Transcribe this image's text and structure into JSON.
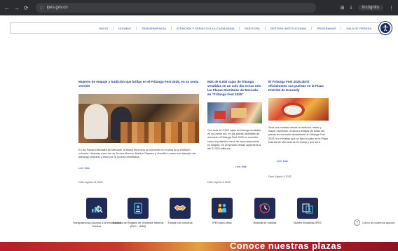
{
  "browser": {
    "url": "ipes.gov.co",
    "profile_label": "Incógnito"
  },
  "menu": {
    "items": [
      "INICIO",
      "IDIOMAS",
      "TRANSPARENCIA",
      "ATENCIÓN Y SERVICIO A LA CIUDADANÍA",
      "PARTICIPA",
      "GESTIÓN INSTITUCIONAL",
      "PROGRAMAS",
      "SALA DE PRENSA"
    ]
  },
  "news": {
    "main": {
      "title": "Mujeres de empuje y tradición que brillan en el Fritanga Fest 2025, en su sexta versión",
      "body": "En las Plazas Distritales de Mercado, la fusión femenina se convierte en el alma de la tradición culinaria. Historias como las de Teresa Moreno, Martha Olayavo y Jenniffer Lozano son ejemplo del liderazgo culinario y amor por la cocina colombiana.",
      "read_more": "Leer Más",
      "date": "Date: Agosto 21 2025"
    },
    "col2": {
      "title": "Más de 5.000 cajas de fritanga vendidas en un solo día en las seis las Plazas Distritales de Mercado en “Fritanga Fest 2025”",
      "body": "Con más de 5.000 cajas de fritanga vendidas en su primer día, en las plazas distritales de mercado el Fritanga Fest 2025 se convirtió como el preferido menú de la jornada social en Bogotá. Se proyectan ventas superiores a las 37.000 millones.",
      "read_more": "Leer Más",
      "date": "Date: Agosto 8 2025"
    },
    "col3": {
      "title": "El Fritanga Fest 2025 abrió oficialmente sus puertas en la Plaza Distrital de Kennedy",
      "body": "Será una muestra desde la tradición, sabor y mayor expresión, música y artistas de todas las plazas de mercado oficialmente el Fritanga Fest 2025, en el evento que se llevó a cabo en la Plaza Distrital de Mercado de Kennedy y que será",
      "read_more": "Leer Más",
      "date": "Date: Agosto 8 2025"
    }
  },
  "services": [
    {
      "label": "Transparencia y Acceso a la Información Pública",
      "icon": "chart-magnifier-icon"
    },
    {
      "label": "Consulta de Registro de Vendedor Informal (RIVI - HeMi)",
      "icon": "document-register-icon"
    },
    {
      "label": "Trabaje con nosotros",
      "icon": "handshake-icon"
    },
    {
      "label": "IPES para niños",
      "icon": "children-icon"
    },
    {
      "label": "Historial de noticias",
      "icon": "history-clock-icon"
    },
    {
      "label": "Boletín Iniciativas IPES",
      "icon": "bulletin-icon"
    }
  ],
  "help": {
    "label": "Cómo te podemos ayudar"
  },
  "banner": {
    "text": "Conoce nuestras plazas"
  },
  "colors": {
    "primary": "#1c3f8f",
    "icon_bg": "#1f2b55",
    "banner": "#b51d2a"
  }
}
